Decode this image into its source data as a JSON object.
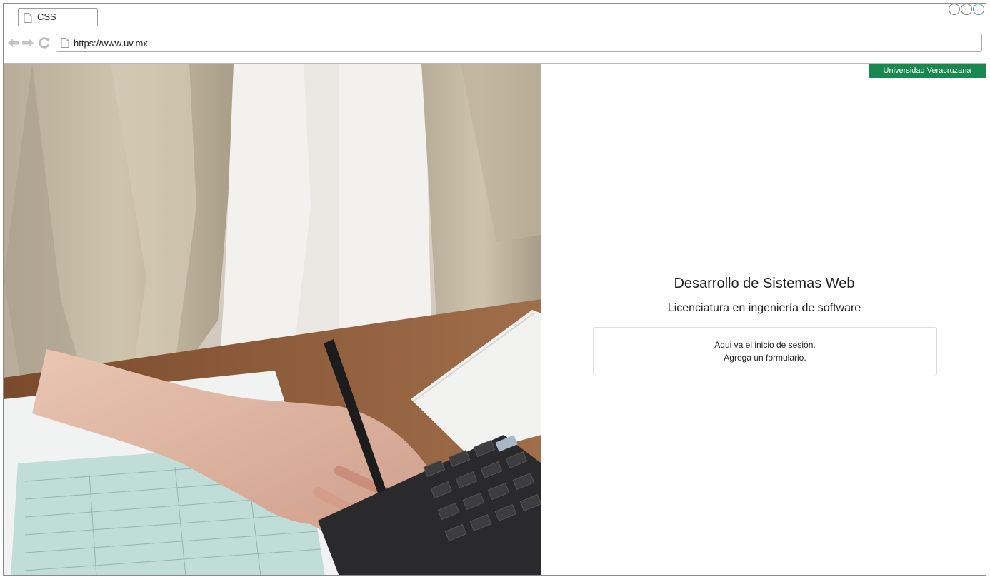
{
  "browser": {
    "tab_title": "CSS",
    "url": "https://www.uv.mx",
    "icons": {
      "back": "arrow-left-icon",
      "forward": "arrow-right-icon",
      "reload": "reload-icon",
      "page": "page-icon"
    }
  },
  "page": {
    "brand": "Universidad Veracruzana",
    "title": "Desarrollo de Sistemas Web",
    "subtitle": "Licenciatura en ingeniería de software",
    "login_placeholder_line1": "Aqui va el inicio de sesión.",
    "login_placeholder_line2": "Agrega un formulario.",
    "brand_color": "#18884f"
  }
}
